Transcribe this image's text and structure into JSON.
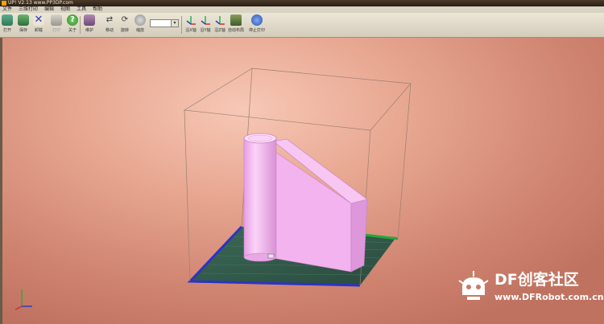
{
  "window": {
    "title": "UP! V2.13 www.PP3DP.com"
  },
  "menu": [
    {
      "id": "file",
      "label": "文件"
    },
    {
      "id": "print3d",
      "label": "三维打印"
    },
    {
      "id": "edit",
      "label": "编辑"
    },
    {
      "id": "view",
      "label": "视图"
    },
    {
      "id": "tools",
      "label": "工具"
    },
    {
      "id": "help",
      "label": "帮助"
    }
  ],
  "toolbar": {
    "open": "打开",
    "save": "保存",
    "unload": "卸载",
    "print": "打印",
    "about": "关于",
    "maintenance": "维护",
    "move": "移动",
    "rotate": "旋转",
    "scale": "缩放",
    "view_x": "沿X轴",
    "view_y": "沿Y轴",
    "view_z": "沿Z轴",
    "auto_place": "自动布局",
    "stop_print": "停止打印",
    "value_box": ""
  },
  "colors": {
    "brand_accent": "#f4a300",
    "model": "#f4b8f0",
    "platform": "#2f5a4a",
    "platform_edge_x": "#2b33c9",
    "platform_edge_y": "#22a83c"
  },
  "watermark": {
    "brand": "DF创客社区",
    "url": "www.DFRobot.com.cn"
  }
}
